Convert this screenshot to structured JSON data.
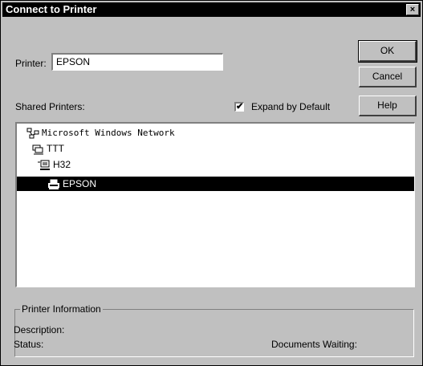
{
  "window": {
    "title": "Connect to Printer",
    "close_glyph": "×"
  },
  "printer_field": {
    "label": "Printer:",
    "value": "EPSON"
  },
  "buttons": {
    "ok": "OK",
    "cancel": "Cancel",
    "help": "Help"
  },
  "shared_printers_label": "Shared Printers:",
  "expand_checkbox": {
    "label": "Expand by Default",
    "checked": true,
    "check_glyph": "✔"
  },
  "tree": {
    "items": [
      {
        "label": "Microsoft Windows Network",
        "icon": "network-icon",
        "level": 0
      },
      {
        "label": "TTT",
        "icon": "domain-icon",
        "level": 1
      },
      {
        "label": "H32",
        "icon": "computer-icon",
        "level": 2
      },
      {
        "label": "EPSON",
        "icon": "printer-icon",
        "level": 3,
        "selected": true
      }
    ]
  },
  "printer_info": {
    "group_title": "Printer Information",
    "description_label": "Description:",
    "status_label": "Status:",
    "documents_waiting_label": "Documents Waiting:"
  },
  "colors": {
    "face": "#c0c0c0",
    "title_bar": "#000000",
    "selection": "#000000"
  }
}
